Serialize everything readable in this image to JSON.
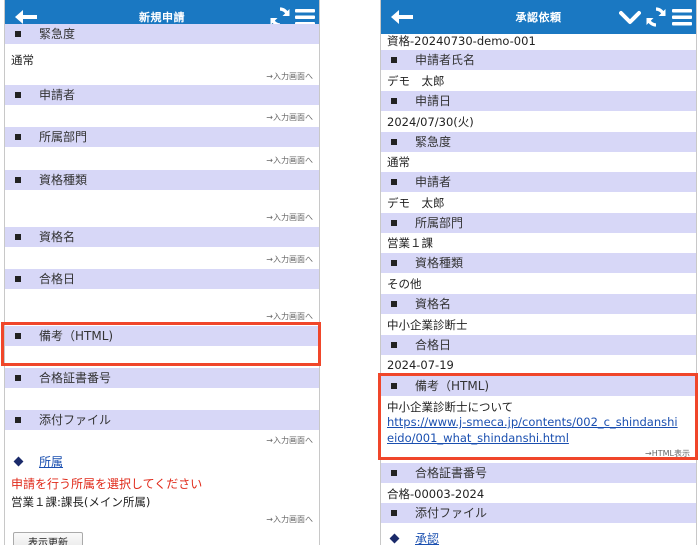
{
  "colors": {
    "appbar": "#1a78c2",
    "section_header": "#d7d7f7",
    "highlight": "#f0462a",
    "link": "#1a4fb0",
    "warning": "#e02a1a"
  },
  "left": {
    "title": "新規申請",
    "icons": [
      "back-arrow-icon",
      "refresh-icon",
      "menu-icon"
    ],
    "sections": [
      {
        "label": "緊急度",
        "value": "通常",
        "link": "→入力画面へ"
      },
      {
        "label": "申請者",
        "value": "",
        "link": "→入力画面へ"
      },
      {
        "label": "所属部門",
        "value": "",
        "link": "→入力画面へ"
      },
      {
        "label": "資格種類",
        "value": "",
        "link": "→入力画面へ"
      },
      {
        "label": "資格名",
        "value": "",
        "link": "→入力画面へ"
      },
      {
        "label": "合格日",
        "value": "",
        "link": "→入力画面へ"
      },
      {
        "label": "備考（HTML)",
        "value": "",
        "link": ""
      },
      {
        "label": "合格証書番号",
        "value": "",
        "link": ""
      },
      {
        "label": "添付ファイル",
        "value": "",
        "link": "→入力画面へ"
      }
    ],
    "affiliation": {
      "label": "所属",
      "warning": "申請を行う所属を選択してください",
      "value": "営業１課:課長(メイン所属)",
      "link": "→入力画面へ",
      "button": "表示更新"
    }
  },
  "right": {
    "title": "承認依頼",
    "icons": [
      "back-arrow-icon",
      "chevron-down-icon",
      "refresh-icon",
      "menu-icon"
    ],
    "top_value": "資格-20240730-demo-001",
    "sections": [
      {
        "label": "申請者氏名",
        "value": "デモ　太郎"
      },
      {
        "label": "申請日",
        "value": "2024/07/30(火)"
      },
      {
        "label": "緊急度",
        "value": "通常"
      },
      {
        "label": "申請者",
        "value": "デモ　太郎"
      },
      {
        "label": "所属部門",
        "value": "営業１課"
      },
      {
        "label": "資格種類",
        "value": "その他"
      },
      {
        "label": "資格名",
        "value": "中小企業診断士"
      },
      {
        "label": "合格日",
        "value": "2024-07-19"
      },
      {
        "label": "備考（HTML)",
        "value": "中小企業診断士について"
      },
      {
        "label": "合格証書番号",
        "value": "合格-00003-2024"
      },
      {
        "label": "添付ファイル",
        "value": ""
      }
    ],
    "url_line1": "https://www.j-smeca.jp/contents/002_c_shindanshi",
    "url_line2": "eido/001_what_shindanshi.html",
    "html_link": "→HTML表示",
    "approval_label": "承認"
  }
}
